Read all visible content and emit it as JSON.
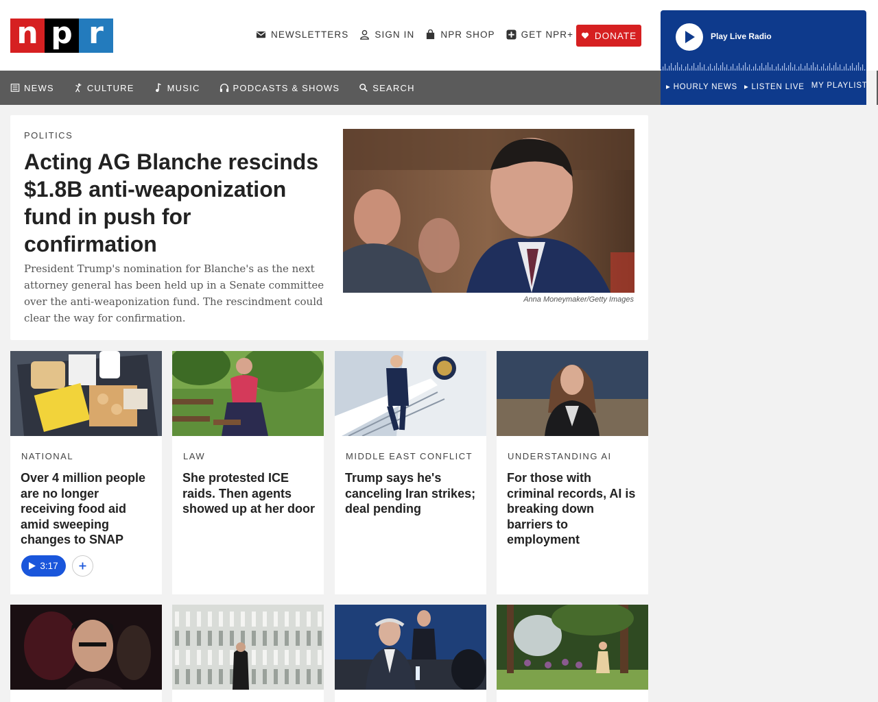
{
  "brand": {
    "logo_letters": [
      "n",
      "p",
      "r"
    ],
    "colors": {
      "red": "#d62021",
      "black": "#000000",
      "blue": "#237bbd"
    }
  },
  "toplinks": [
    {
      "label": "NEWSLETTERS",
      "icon": "envelope-icon"
    },
    {
      "label": "SIGN IN",
      "icon": "user-icon"
    },
    {
      "label": "NPR SHOP",
      "icon": "shopping-bag-icon"
    },
    {
      "label": "GET NPR+",
      "icon": "plus-square-icon"
    }
  ],
  "donate": {
    "label": "DONATE",
    "icon": "heart-icon",
    "color": "#d62021"
  },
  "nav": [
    {
      "label": "NEWS",
      "icon": "newspaper-icon"
    },
    {
      "label": "CULTURE",
      "icon": "dancer-icon"
    },
    {
      "label": "MUSIC",
      "icon": "music-note-icon"
    },
    {
      "label": "PODCASTS & SHOWS",
      "icon": "headphones-icon"
    },
    {
      "label": "SEARCH",
      "icon": "search-icon"
    }
  ],
  "player": {
    "label": "Play Live Radio",
    "links": [
      "HOURLY NEWS",
      "LISTEN LIVE",
      "MY PLAYLIST"
    ],
    "color": "#0e3a8c"
  },
  "lead": {
    "slug": "POLITICS",
    "headline": "Acting AG Blanche rescinds $1.8B anti-weaponization fund in push for confirmation",
    "teaser": "President Trump's nomination for Blanche's as the next attorney general has been held up in a Senate committee over the anti-weaponization fund. The rescindment could clear the way for confirmation.",
    "credit": "Anna Moneymaker/Getty Images"
  },
  "cards": [
    {
      "slug": "NATIONAL",
      "headline": "Over 4 million people are no longer receiving food aid amid sweeping changes to SNAP",
      "audio": "3:17"
    },
    {
      "slug": "LAW",
      "headline": "She protested ICE raids. Then agents showed up at her door"
    },
    {
      "slug": "MIDDLE EAST CONFLICT",
      "headline": "Trump says he's canceling Iran strikes; deal pending"
    },
    {
      "slug": "UNDERSTANDING AI",
      "headline": "For those with criminal records, AI is breaking down barriers to employment"
    }
  ]
}
